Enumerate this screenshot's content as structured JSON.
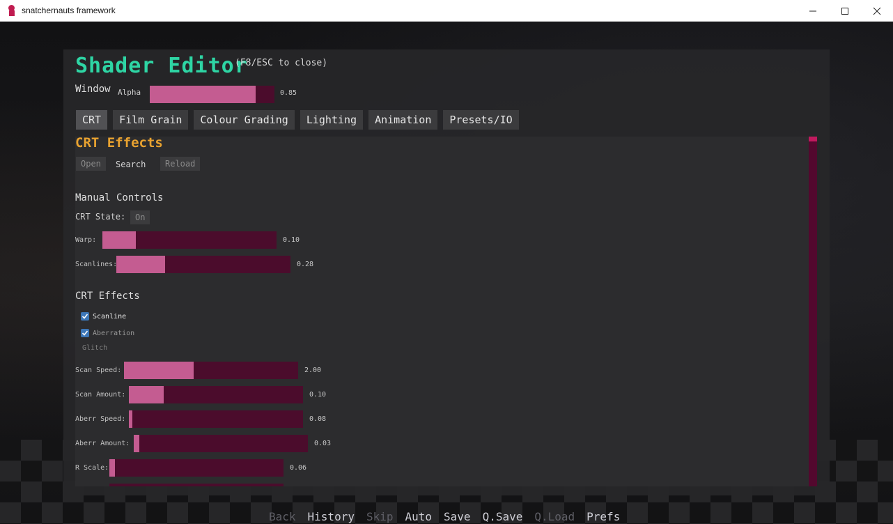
{
  "window": {
    "title": "snatchernauts framework"
  },
  "editor": {
    "title": "Shader Editor",
    "hint": "(F8/ESC to close)",
    "window_label": "Window",
    "alpha": {
      "label": "Alpha",
      "value_text": "0.85",
      "level": 0.85
    },
    "tabs": [
      {
        "label": "CRT",
        "active": true
      },
      {
        "label": "Film Grain",
        "active": false
      },
      {
        "label": "Colour Grading",
        "active": false
      },
      {
        "label": "Lighting",
        "active": false
      },
      {
        "label": "Animation",
        "active": false
      },
      {
        "label": "Presets/IO",
        "active": false
      }
    ],
    "section_title": "CRT Effects",
    "buttons": {
      "open": "Open",
      "search": "Search",
      "reload": "Reload"
    },
    "manual_controls": {
      "heading": "Manual Controls",
      "state_label": "CRT State:",
      "state_value": "On",
      "sliders": [
        {
          "label": "Warp:",
          "value_text": "0.10",
          "level": 0.19
        },
        {
          "label": "Scanlines:",
          "value_text": "0.28",
          "level": 0.28
        }
      ]
    },
    "crt_effects": {
      "heading": "CRT Effects",
      "checks": [
        {
          "label": "Scanline",
          "checked": true
        },
        {
          "label": "Aberration",
          "checked": true
        }
      ],
      "glitch_label": "Glitch",
      "sliders": [
        {
          "label": "Scan Speed:",
          "value_text": "2.00",
          "level": 0.4
        },
        {
          "label": "Scan Amount:",
          "value_text": "0.10",
          "level": 0.2
        },
        {
          "label": "Aberr Speed:",
          "value_text": "0.08",
          "level": 0.02
        },
        {
          "label": "Aberr Amount:",
          "value_text": "0.03",
          "level": 0.03
        },
        {
          "label": "R Scale:",
          "value_text": "0.06",
          "level": 0.03
        }
      ]
    }
  },
  "quick_menu": [
    {
      "label": "Back",
      "enabled": false
    },
    {
      "label": "History",
      "enabled": true
    },
    {
      "label": "Skip",
      "enabled": false
    },
    {
      "label": "Auto",
      "enabled": true
    },
    {
      "label": "Save",
      "enabled": true
    },
    {
      "label": "Q.Save",
      "enabled": true
    },
    {
      "label": "Q.Load",
      "enabled": false
    },
    {
      "label": "Prefs",
      "enabled": true
    }
  ],
  "colors": {
    "title_green": "#2ed5a4",
    "section_orange": "#e8a230",
    "slider_fill": "#c45c91",
    "slider_track": "#4b0c2c",
    "checkbox_blue": "#3d77b8"
  }
}
